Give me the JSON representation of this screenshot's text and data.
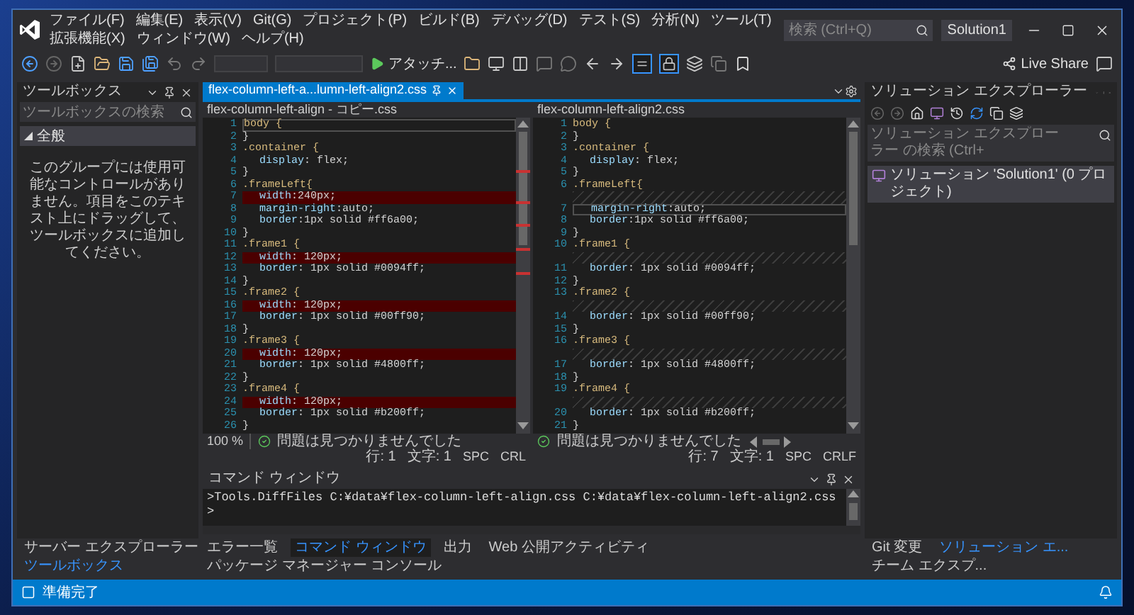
{
  "title_bar": {
    "menu": [
      "ファイル(F)",
      "編集(E)",
      "表示(V)",
      "Git(G)",
      "プロジェクト(P)",
      "ビルド(B)",
      "デバッグ(D)",
      "テスト(S)",
      "分析(N)",
      "ツール(T)",
      "拡張機能(X)",
      "ウィンドウ(W)",
      "ヘルプ(H)"
    ],
    "search": {
      "placeholder": "検索 (Ctrl+Q)"
    },
    "solution": "Solution1"
  },
  "toolbar": {
    "attach": "アタッチ...",
    "live_share": "Live Share",
    "toggles": [
      {
        "pressed": true
      },
      {
        "pressed": true
      }
    ]
  },
  "toolbox": {
    "title": "ツールボックス",
    "search": {
      "placeholder": "ツールボックスの検索"
    },
    "group": {
      "label": "全般",
      "expanded": true
    },
    "message": "このグループには使用可能なコントロールがありません。項目をこのテキスト上にドラッグして、ツールボックスに追加してください。",
    "tabs": [
      {
        "label": "サーバー エクスプローラー",
        "selected": false
      },
      {
        "label": "ツールボックス",
        "selected": true
      }
    ]
  },
  "editor": {
    "tabs": [
      {
        "label": "flex-column-left-a...lumn-left-align2.css",
        "selected": true
      }
    ],
    "panes": [
      {
        "title": "flex-column-left-align - コピー.css",
        "zoom": "100 %",
        "status": "問題は見つかりませんでした",
        "line": "行: 1",
        "col": "文字: 1",
        "spacing": "SPC",
        "ending": "CRL",
        "lines": [
          {
            "n": "1",
            "text": "body {",
            "kind": "selector",
            "changed": false,
            "current": true
          },
          {
            "n": "2",
            "text": "}",
            "kind": "brace",
            "changed": false,
            "current": false
          },
          {
            "n": "3",
            "text": ".container {",
            "kind": "selector",
            "changed": false,
            "current": false
          },
          {
            "n": "4",
            "text": "display: flex;",
            "kind": "declaration",
            "changed": false,
            "current": false
          },
          {
            "n": "5",
            "text": "}",
            "kind": "brace",
            "changed": false,
            "current": false
          },
          {
            "n": "6",
            "text": ".frameLeft{",
            "kind": "selector",
            "changed": false,
            "current": false
          },
          {
            "n": "7",
            "text": "width:240px;",
            "kind": "declaration",
            "changed": true,
            "current": false
          },
          {
            "n": "8",
            "text": "margin-right:auto;",
            "kind": "declaration",
            "changed": false,
            "current": false
          },
          {
            "n": "9",
            "text": "border:1px solid #ff6a00;",
            "kind": "declaration",
            "changed": false,
            "current": false
          },
          {
            "n": "10",
            "text": "}",
            "kind": "brace",
            "changed": false,
            "current": false
          },
          {
            "n": "11",
            "text": ".frame1 {",
            "kind": "selector",
            "changed": false,
            "current": false
          },
          {
            "n": "12",
            "text": "width: 120px;",
            "kind": "declaration",
            "changed": true,
            "current": false
          },
          {
            "n": "13",
            "text": "border: 1px solid #0094ff;",
            "kind": "declaration",
            "changed": false,
            "current": false
          },
          {
            "n": "14",
            "text": "}",
            "kind": "brace",
            "changed": false,
            "current": false
          },
          {
            "n": "15",
            "text": ".frame2 {",
            "kind": "selector",
            "changed": false,
            "current": false
          },
          {
            "n": "16",
            "text": "width: 120px;",
            "kind": "declaration",
            "changed": true,
            "current": false
          },
          {
            "n": "17",
            "text": "border: 1px solid #00ff90;",
            "kind": "declaration",
            "changed": false,
            "current": false
          },
          {
            "n": "18",
            "text": "}",
            "kind": "brace",
            "changed": false,
            "current": false
          },
          {
            "n": "19",
            "text": ".frame3 {",
            "kind": "selector",
            "changed": false,
            "current": false
          },
          {
            "n": "20",
            "text": "width: 120px;",
            "kind": "declaration",
            "changed": true,
            "current": false
          },
          {
            "n": "21",
            "text": "border: 1px solid #4800ff;",
            "kind": "declaration",
            "changed": false,
            "current": false
          },
          {
            "n": "22",
            "text": "}",
            "kind": "brace",
            "changed": false,
            "current": false
          },
          {
            "n": "23",
            "text": ".frame4 {",
            "kind": "selector",
            "changed": false,
            "current": false
          },
          {
            "n": "24",
            "text": "width: 120px;",
            "kind": "declaration",
            "changed": true,
            "current": false
          },
          {
            "n": "25",
            "text": "border: 1px solid #b200ff;",
            "kind": "declaration",
            "changed": false,
            "current": false
          },
          {
            "n": "26",
            "text": "}",
            "kind": "brace",
            "changed": false,
            "current": false
          }
        ]
      },
      {
        "title": "flex-column-left-align2.css",
        "status": "問題は見つかりませんでした",
        "line": "行: 7",
        "col": "文字: 1",
        "spacing": "SPC",
        "ending": "CRLF",
        "lines": [
          {
            "n": "1",
            "text": "body {",
            "kind": "selector",
            "current": false
          },
          {
            "n": "2",
            "text": "}",
            "kind": "brace",
            "current": false
          },
          {
            "n": "3",
            "text": ".container {",
            "kind": "selector",
            "current": false
          },
          {
            "n": "4",
            "text": "display: flex;",
            "kind": "declaration",
            "current": false
          },
          {
            "n": "5",
            "text": "}",
            "kind": "brace",
            "current": false
          },
          {
            "n": "6",
            "text": ".frameLeft{",
            "kind": "selector",
            "current": false
          },
          {
            "kind": "gap",
            "current": false
          },
          {
            "n": "7",
            "text": "margin-right:auto;",
            "kind": "declaration",
            "current": true
          },
          {
            "n": "8",
            "text": "border:1px solid #ff6a00;",
            "kind": "declaration",
            "current": false
          },
          {
            "n": "9",
            "text": "}",
            "kind": "brace",
            "current": false
          },
          {
            "n": "10",
            "text": ".frame1 {",
            "kind": "selector",
            "current": false
          },
          {
            "kind": "gap",
            "current": false
          },
          {
            "n": "11",
            "text": "border: 1px solid #0094ff;",
            "kind": "declaration",
            "current": false
          },
          {
            "n": "12",
            "text": "}",
            "kind": "brace",
            "current": false
          },
          {
            "n": "13",
            "text": ".frame2 {",
            "kind": "selector",
            "current": false
          },
          {
            "kind": "gap",
            "current": false
          },
          {
            "n": "14",
            "text": "border: 1px solid #00ff90;",
            "kind": "declaration",
            "current": false
          },
          {
            "n": "15",
            "text": "}",
            "kind": "brace",
            "current": false
          },
          {
            "n": "16",
            "text": ".frame3 {",
            "kind": "selector",
            "current": false
          },
          {
            "kind": "gap",
            "current": false
          },
          {
            "n": "17",
            "text": "border: 1px solid #4800ff;",
            "kind": "declaration",
            "current": false
          },
          {
            "n": "18",
            "text": "}",
            "kind": "brace",
            "current": false
          },
          {
            "n": "19",
            "text": ".frame4 {",
            "kind": "selector",
            "current": false
          },
          {
            "kind": "gap",
            "current": false
          },
          {
            "n": "20",
            "text": "border: 1px solid #b200ff;",
            "kind": "declaration",
            "current": false
          },
          {
            "n": "21",
            "text": "}",
            "kind": "brace",
            "current": false
          }
        ]
      }
    ]
  },
  "command_window": {
    "title": "コマンド ウィンドウ",
    "lines": [
      ">Tools.DiffFiles C:¥data¥flex-column-left-align.css C:¥data¥flex-column-left-align2.css",
      ">"
    ]
  },
  "bottom_tabs": [
    {
      "label": "エラー一覧",
      "selected": false
    },
    {
      "label": "コマンド ウィンドウ",
      "selected": true
    },
    {
      "label": "出力",
      "selected": false
    },
    {
      "label": "Web 公開アクティビティ",
      "selected": false
    },
    {
      "label": "パッケージ マネージャー コンソール",
      "selected": false
    }
  ],
  "solution_explorer": {
    "title": "ソリューション エクスプローラー",
    "search": {
      "placeholder": "ソリューション エクスプローラー の検索 (Ctrl+"
    },
    "item": "ソリューション 'Solution1' (0 プロジェクト)",
    "tabs": [
      {
        "label": "Git 変更",
        "selected": false
      },
      {
        "label": "ソリューション エ...",
        "selected": true
      },
      {
        "label": "チーム エクスプ...",
        "selected": false
      }
    ]
  },
  "status_bar": {
    "text": "準備完了"
  }
}
